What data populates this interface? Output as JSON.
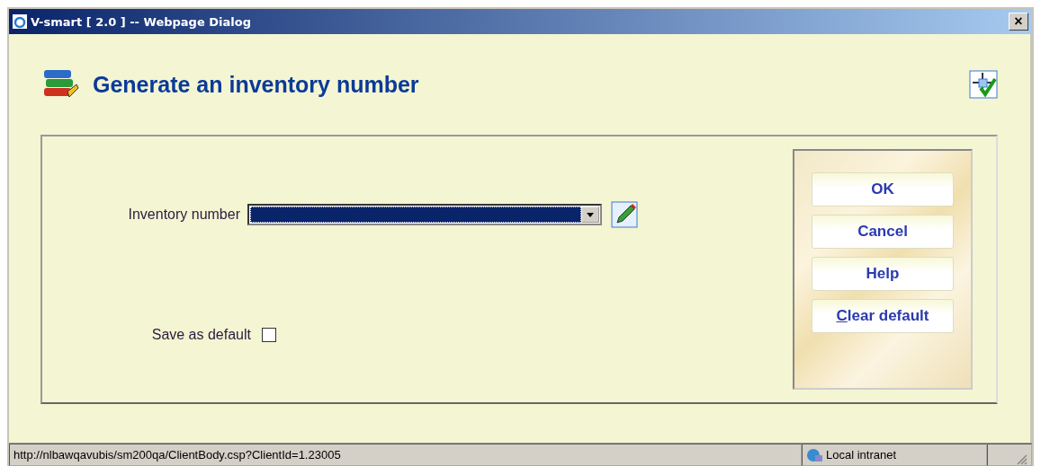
{
  "window": {
    "title": "V-smart [ 2.0 ] -- Webpage Dialog",
    "close": "×"
  },
  "page": {
    "title": "Generate an inventory number"
  },
  "form": {
    "inventory": {
      "label": "Inventory number",
      "selected": true
    },
    "save_default": {
      "label": "Save as default",
      "checked": false
    }
  },
  "buttons": [
    {
      "label": "OK",
      "kind": "plain"
    },
    {
      "label": "Cancel",
      "kind": "plain"
    },
    {
      "label": "Help",
      "kind": "plain"
    },
    {
      "label": "Clear default",
      "kind": "accesskey"
    }
  ],
  "status_bar": {
    "url": "http://nlbawqavubis/sm200qa/ClientBody.csp?ClientId=1.23005",
    "zone": "Local intranet"
  }
}
